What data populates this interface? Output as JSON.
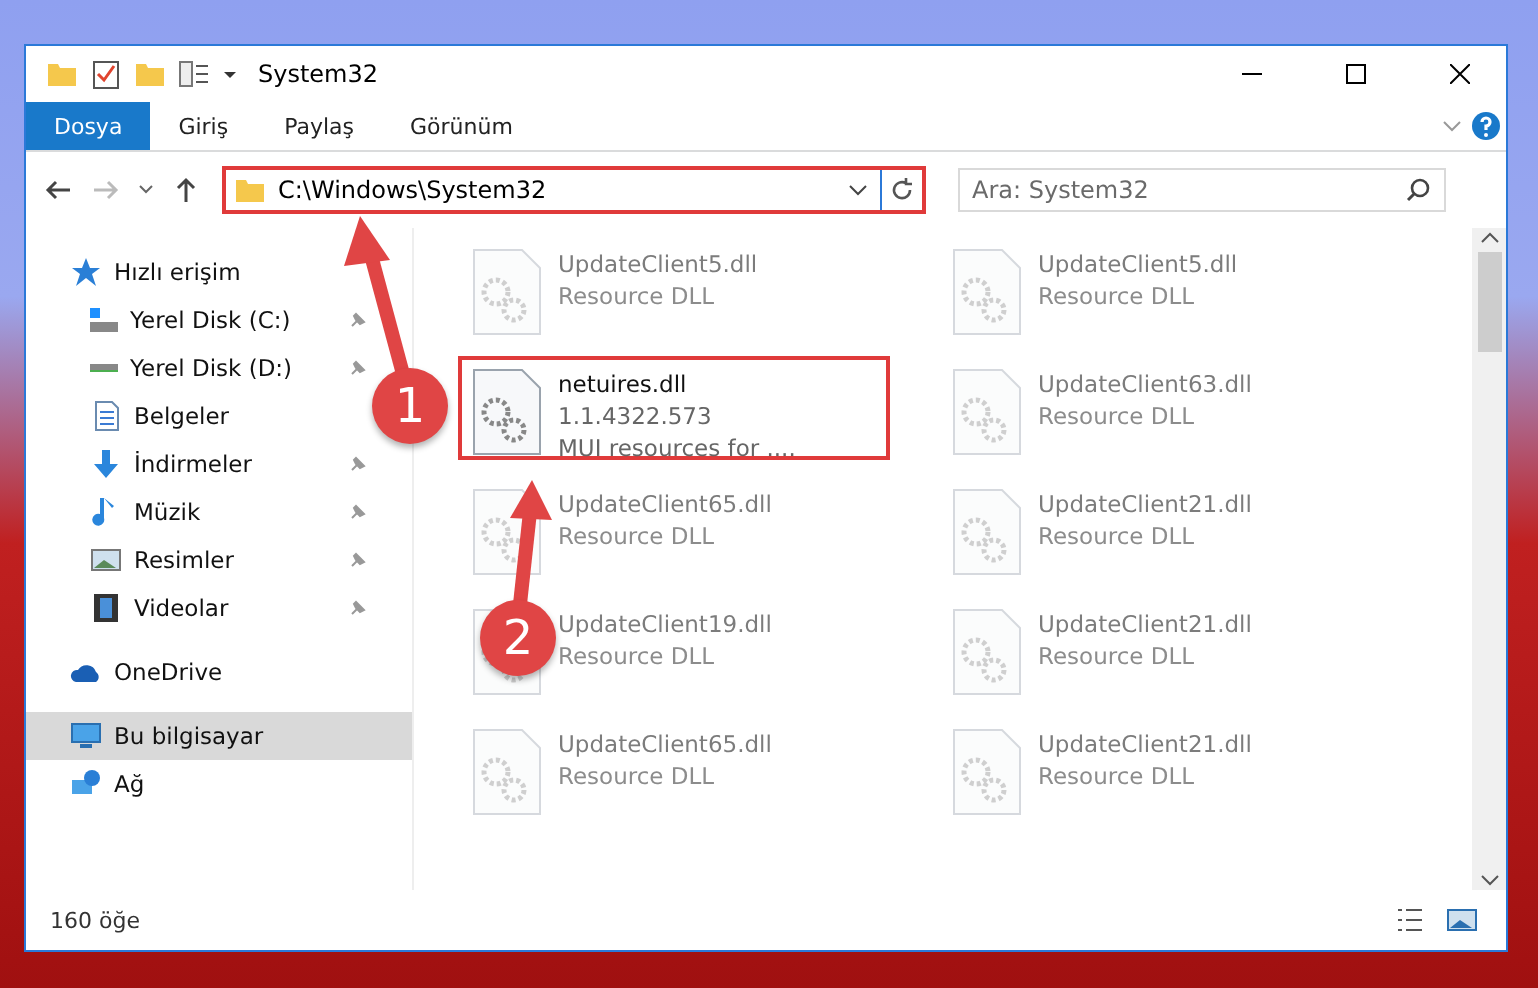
{
  "window": {
    "title": "System32"
  },
  "ribbon_tabs": [
    {
      "label": "Dosya",
      "selected": true
    },
    {
      "label": "Giriş",
      "selected": false
    },
    {
      "label": "Paylaş",
      "selected": false
    },
    {
      "label": "Görünüm",
      "selected": false
    }
  ],
  "address": {
    "value": "C:\\Windows\\System32"
  },
  "search": {
    "placeholder": "Ara: System32"
  },
  "sidebar": {
    "items": [
      {
        "label": "Hızlı erişim",
        "kind": "star",
        "selected": false,
        "children": [
          {
            "label": "Yerel Disk (C:)",
            "kind": "system-drive",
            "pinned": true,
            "selected": false
          },
          {
            "label": "Yerel Disk (D:)",
            "kind": "drive",
            "pinned": true,
            "selected": false
          },
          {
            "label": "Belgeler",
            "kind": "documents",
            "pinned": false,
            "selected": false
          },
          {
            "label": "İndirmeler",
            "kind": "downloads",
            "pinned": true,
            "selected": false
          },
          {
            "label": "Müzik",
            "kind": "music",
            "pinned": true,
            "selected": false
          },
          {
            "label": "Resimler",
            "kind": "pictures",
            "pinned": true,
            "selected": false
          },
          {
            "label": "Videolar",
            "kind": "videos",
            "pinned": true,
            "selected": false
          }
        ]
      },
      {
        "label": "OneDrive",
        "kind": "cloud",
        "selected": false
      },
      {
        "label": "Bu bilgisayar",
        "kind": "computer",
        "selected": true
      },
      {
        "label": "Ağ",
        "kind": "network",
        "selected": false
      }
    ]
  },
  "files": [
    {
      "name": "UpdateClient5.dll",
      "lines": [
        "Resource DLL"
      ],
      "blurred": true,
      "highlighted": false
    },
    {
      "name": "UpdateClient5.dll",
      "lines": [
        "Resource DLL"
      ],
      "blurred": true,
      "highlighted": false
    },
    {
      "name": "netuires.dll",
      "lines": [
        "1.1.4322.573",
        "MUI resources for ...."
      ],
      "blurred": false,
      "highlighted": true
    },
    {
      "name": "UpdateClient63.dll",
      "lines": [
        "Resource DLL"
      ],
      "blurred": true,
      "highlighted": false
    },
    {
      "name": "UpdateClient65.dll",
      "lines": [
        "Resource DLL"
      ],
      "blurred": true,
      "highlighted": false
    },
    {
      "name": "UpdateClient21.dll",
      "lines": [
        "Resource DLL"
      ],
      "blurred": true,
      "highlighted": false
    },
    {
      "name": "UpdateClient19.dll",
      "lines": [
        "Resource DLL"
      ],
      "blurred": true,
      "highlighted": false
    },
    {
      "name": "UpdateClient21.dll",
      "lines": [
        "Resource DLL"
      ],
      "blurred": true,
      "highlighted": false
    },
    {
      "name": "UpdateClient65.dll",
      "lines": [
        "Resource DLL"
      ],
      "blurred": true,
      "highlighted": false
    },
    {
      "name": "UpdateClient21.dll",
      "lines": [
        "Resource DLL"
      ],
      "blurred": true,
      "highlighted": false
    }
  ],
  "status_bar": {
    "count": "160 öğe"
  },
  "annotations": [
    {
      "label": "1"
    },
    {
      "label": "2"
    }
  ]
}
